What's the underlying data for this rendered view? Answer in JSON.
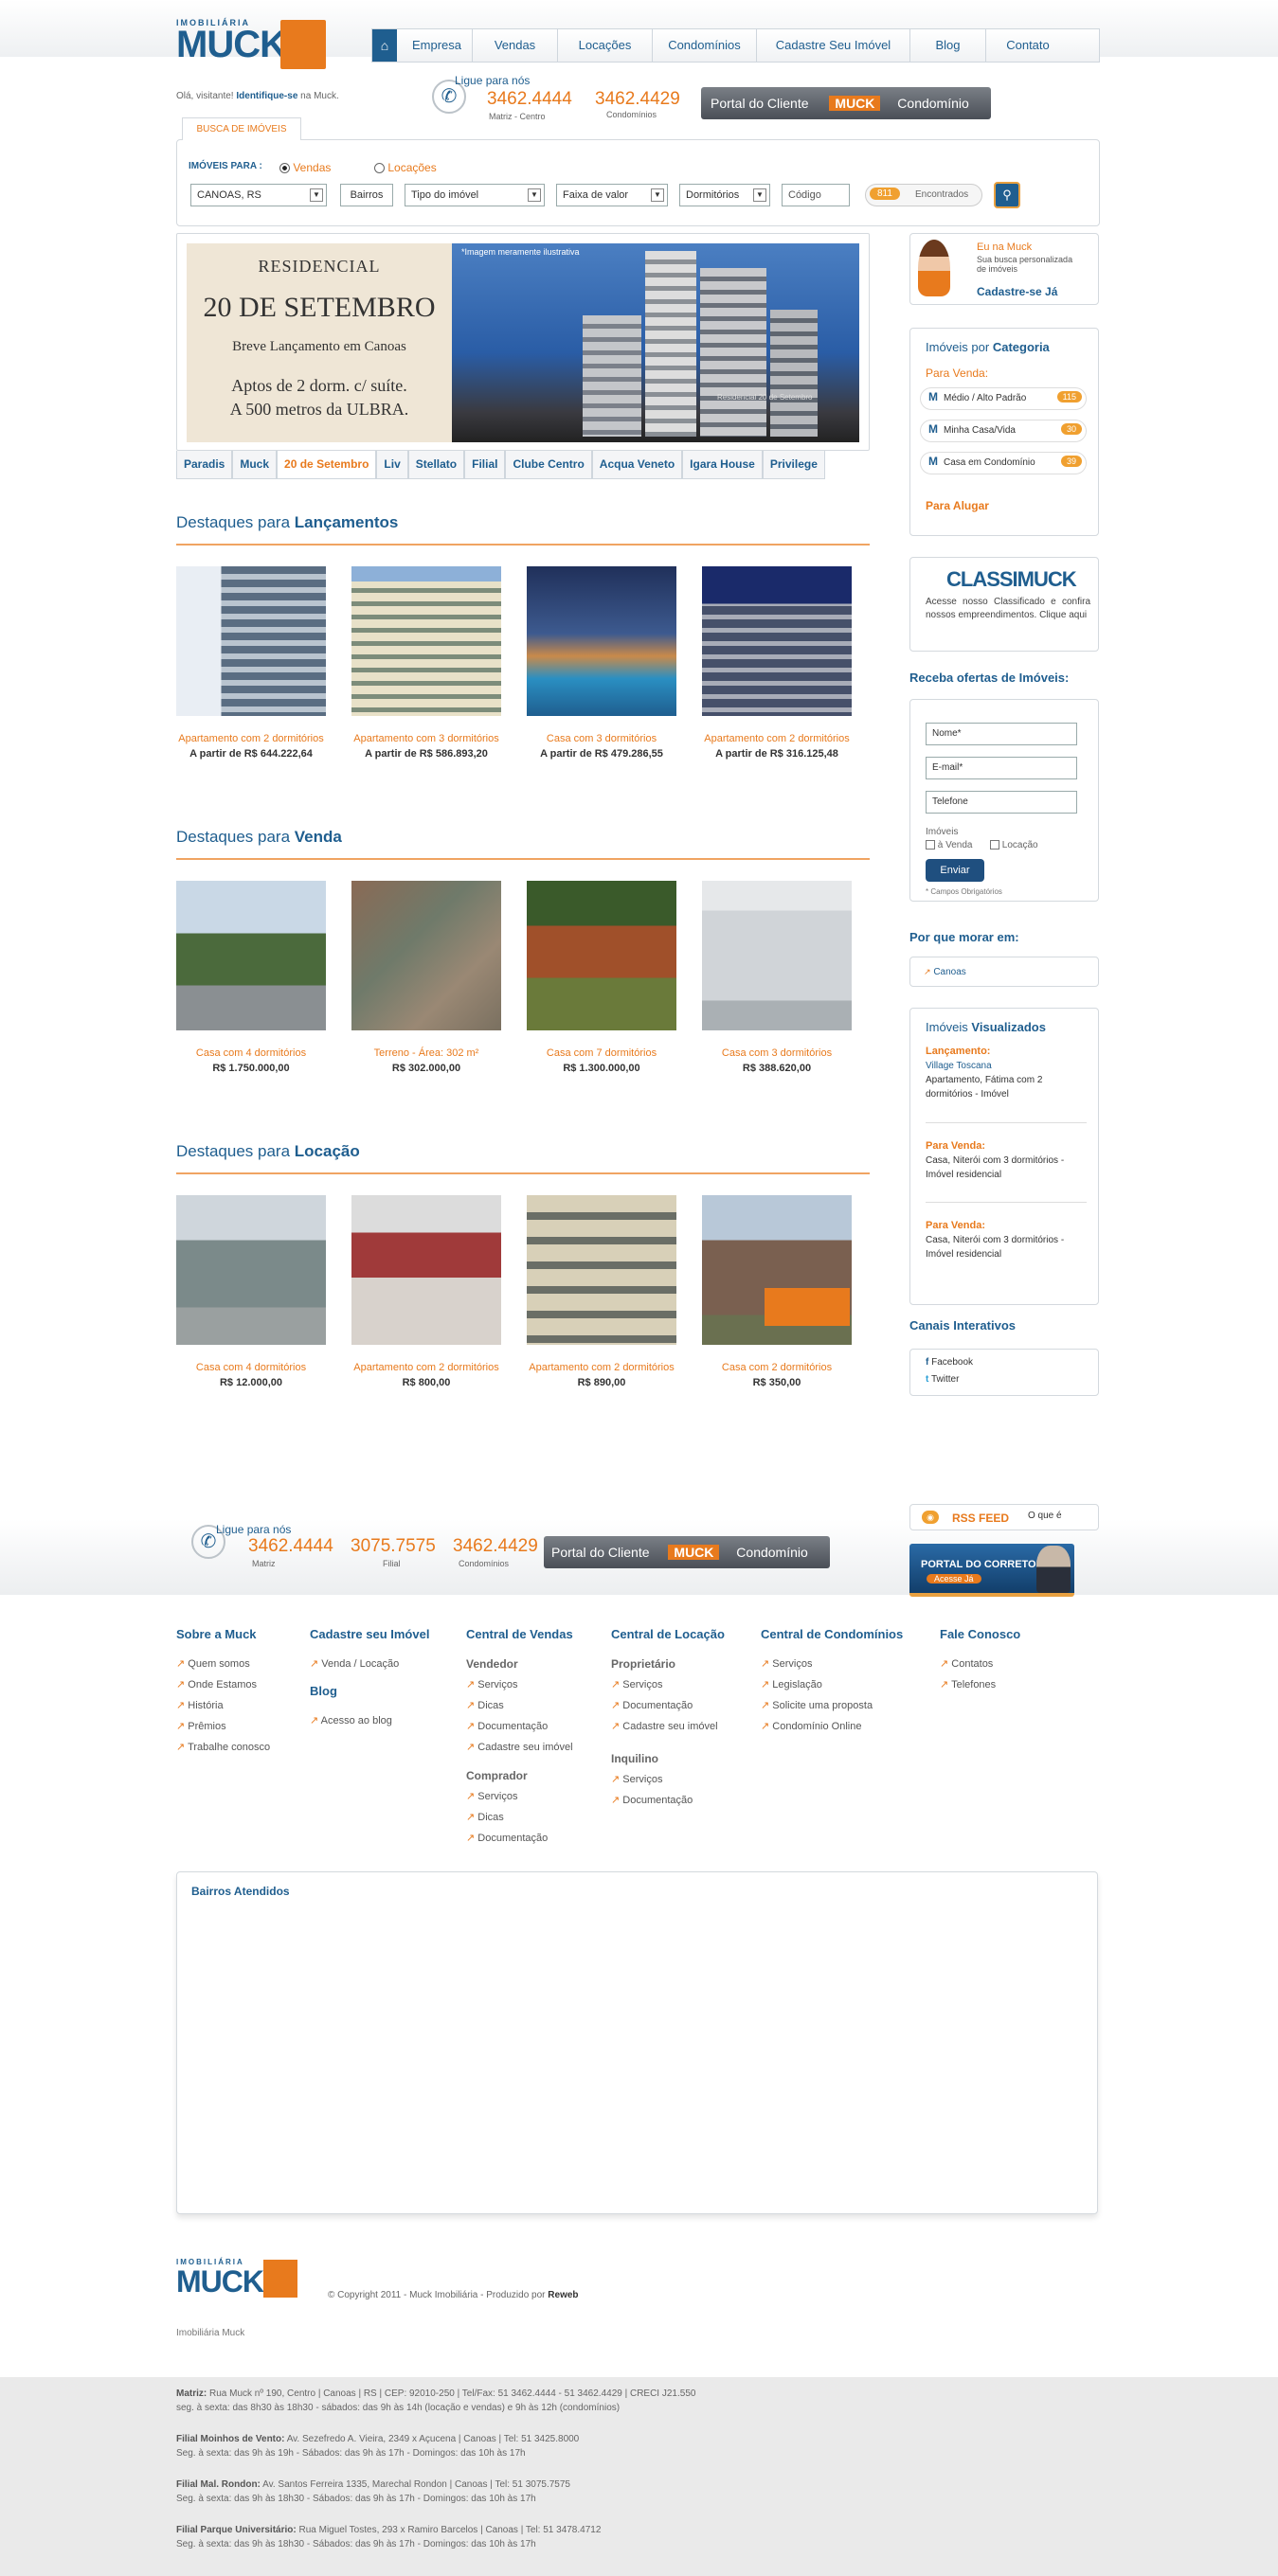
{
  "header": {
    "logo_top": "IMOBILIÁRIA",
    "logo_main": "MUCK",
    "greeting": "Olá, visitante!",
    "identify": "Identifique-se",
    "greeting_tail": "na Muck.",
    "nav": [
      "Empresa",
      "Vendas",
      "Locações",
      "Condomínios",
      "Cadastre Seu Imóvel",
      "Blog",
      "Contato"
    ],
    "call_label": "Ligue para nós",
    "phone1": "3462.4444",
    "phone1_sub": "Matriz - Centro",
    "phone2": "3462.4429",
    "phone2_sub": "Condomínios",
    "portal_label": "Portal do Cliente",
    "portal_brand": "MUCK",
    "portal_right": "Condomínio"
  },
  "search": {
    "tab": "BUSCA DE IMÓVEIS",
    "label": "IMÓVEIS PARA :",
    "opt_vendas": "Vendas",
    "opt_locacoes": "Locações",
    "city": "CANOAS, RS",
    "bairros": "Bairros",
    "tipo": "Tipo do imóvel",
    "faixa": "Faixa de valor",
    "dorm": "Dormitórios",
    "codigo": "Código",
    "found_count": "811",
    "found_label": "Encontrados"
  },
  "banner": {
    "residencial": "RESIDENCIAL",
    "name": "20 DE SETEMBRO",
    "line1": "Breve Lançamento em Canoas",
    "line2": "Aptos de 2 dorm. c/ suíte.",
    "line3": "A 500 metros da ULBRA.",
    "note": "*Imagem meramente ilustrativa",
    "sign": "Residencial 20 de Setembro",
    "tabs": [
      "Paradis",
      "Muck",
      "20 de Setembro",
      "Liv",
      "Stellato",
      "Filial",
      "Clube Centro",
      "Acqua Veneto",
      "Igara House",
      "Privilege"
    ]
  },
  "lancamentos": {
    "title_pre": "Destaques para",
    "title_bold": "Lançamentos",
    "items": [
      {
        "title": "Apartamento com 2 dormitórios",
        "price": "A partir de R$ 644.222,64"
      },
      {
        "title": "Apartamento com 3 dormitórios",
        "price": "A partir de R$ 586.893,20"
      },
      {
        "title": "Casa com 3 dormitórios",
        "price": "A partir de R$ 479.286,55"
      },
      {
        "title": "Apartamento com 2 dormitórios",
        "price": "A partir de R$ 316.125,48"
      }
    ]
  },
  "venda": {
    "title_pre": "Destaques para",
    "title_bold": "Venda",
    "items": [
      {
        "title": "Casa com 4 dormitórios",
        "price": "R$ 1.750.000,00"
      },
      {
        "title": "Terreno - Área: 302 m²",
        "price": "R$ 302.000,00"
      },
      {
        "title": "Casa com 7 dormitórios",
        "price": "R$ 1.300.000,00"
      },
      {
        "title": "Casa com 3 dormitórios",
        "price": "R$ 388.620,00"
      }
    ]
  },
  "locacao": {
    "title_pre": "Destaques para",
    "title_bold": "Locação",
    "items": [
      {
        "title": "Casa com 4 dormitórios",
        "price": "R$ 12.000,00"
      },
      {
        "title": "Apartamento com 2 dormitórios",
        "price": "R$ 800,00"
      },
      {
        "title": "Apartamento com 2 dormitórios",
        "price": "R$ 890,00"
      },
      {
        "title": "Casa com 2 dormitórios",
        "price": "R$ 350,00"
      }
    ]
  },
  "sidebar": {
    "eu_title": "Eu na Muck",
    "eu_text": "Sua busca personalizada de imóveis",
    "eu_cta": "Cadastre-se Já",
    "cat_title_pre": "Imóveis por",
    "cat_title_bold": "Categoria",
    "cat_venda": "Para Venda:",
    "cats": [
      {
        "label": "Médio / Alto Padrão",
        "count": "115"
      },
      {
        "label": "Minha Casa/Vida",
        "count": "30"
      },
      {
        "label": "Casa em Condomínio",
        "count": "39"
      }
    ],
    "cat_alugar": "Para Alugar",
    "classi_logo": "CLASSIMUCK",
    "classi_text": "Acesse nosso Classificado e confira nossos empreendimentos. Clique aqui",
    "ofertas_title": "Receba ofertas de Imóveis:",
    "f_nome": "Nome*",
    "f_email": "E-mail*",
    "f_tel": "Telefone",
    "f_imoveis": "Imóveis",
    "f_venda": "à Venda",
    "f_loc": "Locação",
    "f_btn": "Enviar",
    "f_req": "* Campos Obrigatórios",
    "morar_title": "Por que morar em:",
    "morar_city": "Canoas",
    "vis_title_pre": "Imóveis",
    "vis_title_bold": "Visualizados",
    "vis": [
      {
        "h": "Lançamento:",
        "link": "Village Toscana",
        "t": "Apartamento, Fátima com 2 dormitórios - Imóvel"
      },
      {
        "h": "Para Venda:",
        "link": "",
        "t": "Casa, Niterói com 3 dormitórios - Imóvel residencial"
      },
      {
        "h": "Para Venda:",
        "link": "",
        "t": "Casa, Niterói com 3 dormitórios - Imóvel residencial"
      }
    ],
    "canais_title": "Canais Interativos",
    "facebook": "Facebook",
    "twitter": "Twitter"
  },
  "band": {
    "call": "Ligue para nós",
    "p1": "3462.4444",
    "p1s": "Matriz",
    "p2": "3075.7575",
    "p2s": "Filial",
    "p3": "3462.4429",
    "p3s": "Condomínios",
    "portal": "Portal do Cliente",
    "portal_brand": "MUCK",
    "portal_right": "Condomínio",
    "rss": "RSS FEED",
    "oque": "O que é",
    "corretor": "PORTAL DO CORRETOR",
    "corretor_sub": "Acesse Já"
  },
  "footer_links": {
    "c1": {
      "h": "Sobre a Muck",
      "items": [
        "Quem somos",
        "Onde Estamos",
        "História",
        "Prêmios",
        "Trabalhe conosco"
      ]
    },
    "c2": {
      "h": "Cadastre seu Imóvel",
      "items": [
        "Venda / Locação"
      ],
      "h2": "Blog",
      "items2": [
        "Acesso ao blog"
      ]
    },
    "c3": {
      "h": "Central de Vendas",
      "sh1": "Vendedor",
      "items": [
        "Serviços",
        "Dicas",
        "Documentação",
        "Cadastre seu imóvel"
      ],
      "sh2": "Comprador",
      "items2": [
        "Serviços",
        "Dicas",
        "Documentação"
      ]
    },
    "c4": {
      "h": "Central de Locação",
      "sh1": "Proprietário",
      "items": [
        "Serviços",
        "Documentação",
        "Cadastre seu imóvel"
      ],
      "sh2": "Inquilino",
      "items2": [
        "Serviços",
        "Documentação"
      ]
    },
    "c5": {
      "h": "Central de Condomínios",
      "items": [
        "Serviços",
        "Legislação",
        "Solicite uma proposta",
        "Condomínio Online"
      ]
    },
    "c6": {
      "h": "Fale Conosco",
      "items": [
        "Contatos",
        "Telefones"
      ]
    }
  },
  "bairros": {
    "title": "Bairros Atendidos"
  },
  "copyright": {
    "text": "© Copyright 2011 - Muck Imobiliária - Produzido por",
    "reweb": "Reweb",
    "tag": "Imobiliária Muck"
  },
  "addresses": [
    {
      "b": "Matriz:",
      "t": "Rua Muck nº 190, Centro | Canoas | RS | CEP: 92010-250 | Tel/Fax: 51 3462.4444 - 51 3462.4429 | CRECI J21.550",
      "t2": "seg. à sexta: das 8h30 às 18h30 - sábados: das 9h às 14h (locação e vendas) e 9h às 12h (condomínios)"
    },
    {
      "b": "Filial Moinhos de Vento:",
      "t": "Av. Sezefredo A. Vieira, 2349 x Açucena | Canoas | Tel: 51 3425.8000",
      "t2": "Seg. à sexta: das 9h às 19h - Sábados: das 9h às 17h - Domingos: das 10h às 17h"
    },
    {
      "b": "Filial Mal. Rondon:",
      "t": "Av. Santos Ferreira 1335, Marechal Rondon | Canoas | Tel: 51 3075.7575",
      "t2": "Seg. à sexta: das 9h às 18h30 - Sábados: das 9h às 17h - Domingos: das 10h às 17h"
    },
    {
      "b": "Filial Parque Universitário:",
      "t": "Rua Miguel Tostes, 293 x Ramiro Barcelos | Canoas | Tel: 51 3478.4712",
      "t2": "Seg. à sexta: das 9h às 18h30 - Sábados: das 9h às 17h - Domingos: das 10h às 17h"
    }
  ]
}
